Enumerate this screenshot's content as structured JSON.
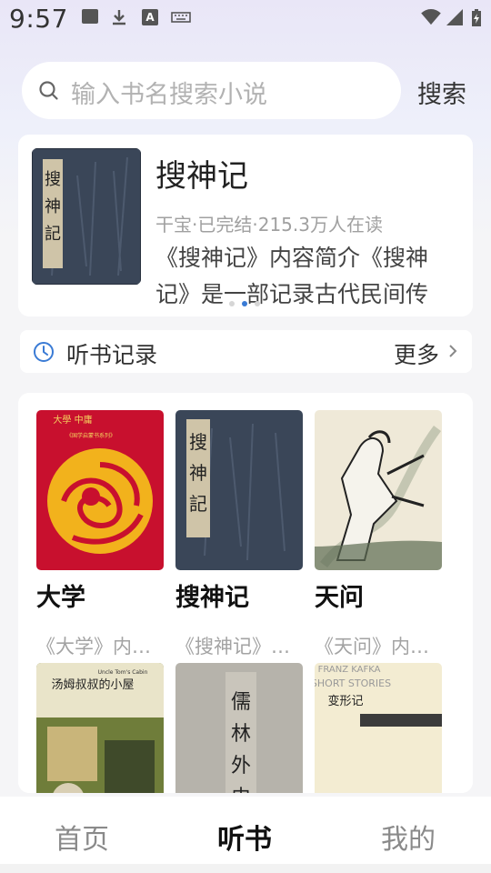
{
  "status_bar": {
    "time": "9:57",
    "icons": [
      "image-icon",
      "download-icon",
      "text-a-icon",
      "keyboard-icon",
      "wifi-icon",
      "signal-icon",
      "battery-charging-icon"
    ]
  },
  "search": {
    "placeholder": "输入书名搜索小说",
    "button_label": "搜索"
  },
  "banner": {
    "title": "搜神记",
    "meta": "干宝·已完结·215.3万人在读",
    "description": "《搜神记》内容简介《搜神记》是一部记录古代民间传",
    "slides_count": 3,
    "active_slide": 2,
    "cover_text": "搜神記"
  },
  "listen_record": {
    "label": "听书记录",
    "more_label": "更多"
  },
  "books": [
    {
      "title": "大学",
      "desc": "《大学》内容简介",
      "cover_text": "大學 中庸"
    },
    {
      "title": "搜神记",
      "desc": "《搜神记》内容简介",
      "cover_text": "搜神記"
    },
    {
      "title": "天问",
      "desc": "《天问》内容简介",
      "cover_text": ""
    },
    {
      "title": "",
      "desc": "",
      "cover_text": "汤姆叔叔的小屋"
    },
    {
      "title": "",
      "desc": "",
      "cover_text": "儒林外史"
    },
    {
      "title": "",
      "desc": "",
      "cover_text": "变形记"
    }
  ],
  "book_cover_extra": {
    "tom_header": "Uncle Tom's Cabin",
    "kafka_header": "FRANZ KAFKA",
    "kafka_sub": "SHORT STORIES",
    "daxue_sub": "《国学启蒙书系列》"
  },
  "bottom_nav": {
    "items": [
      "首页",
      "听书",
      "我的"
    ],
    "active": "听书"
  },
  "colors": {
    "accent": "#3a7bd5",
    "red_cover": "#c8102e",
    "gold": "#f2b21c"
  }
}
